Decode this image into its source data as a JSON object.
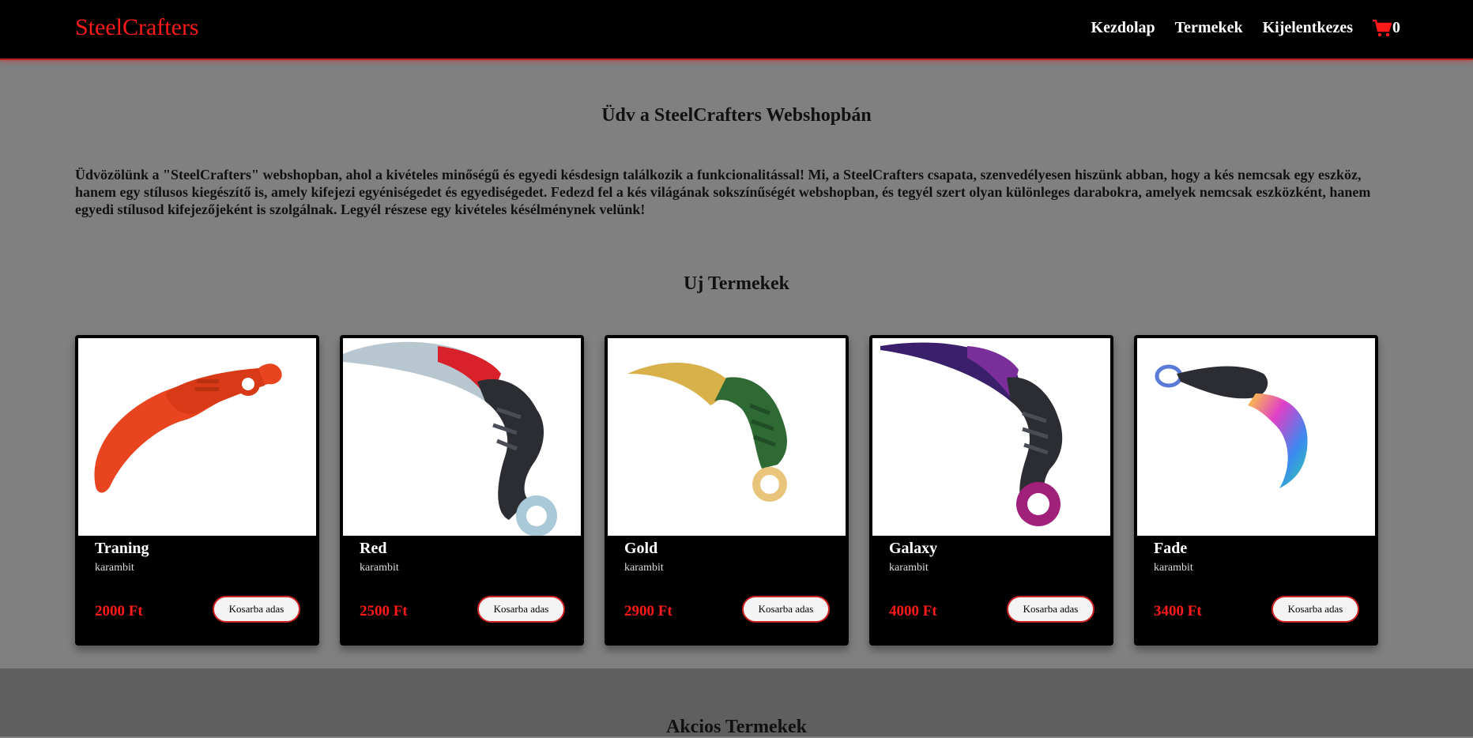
{
  "header": {
    "brand": "SteelCrafters",
    "nav": [
      "Kezdolap",
      "Termekek",
      "Kijelentkezes"
    ],
    "cart_count": "0",
    "colors": {
      "background": "#000000",
      "accent": "#ff1a1a"
    }
  },
  "welcome": {
    "title": "Üdv a SteelCrafters Webshopbán",
    "text": "Üdvözölünk a \"SteelCrafters\" webshopban, ahol a kivételes minőségű és egyedi késdesign találkozik a funkcionalitással! Mi, a SteelCrafters csapata, szenvedélyesen hiszünk abban, hogy a kés nemcsak egy eszköz, hanem egy stílusos kiegészítő is, amely kifejezi egyéniségedet és egyediségedet. Fedezd fel a kés világának sokszínűségét webshopban, és tegyél szert olyan különleges darabokra, amelyek nemcsak eszközként, hanem egyedi stílusod kifejezőjeként is szolgálnak. Legyél részese egy kivételes késélménynek velünk!"
  },
  "new_products": {
    "title": "Uj Termekek",
    "button_label": "Kosarba adas",
    "items": [
      {
        "name": "Traning",
        "type": "karambit",
        "price": "2000 Ft",
        "image": "orange-training-karambit"
      },
      {
        "name": "Red",
        "type": "karambit",
        "price": "2500 Ft",
        "image": "red-karambit"
      },
      {
        "name": "Gold",
        "type": "karambit",
        "price": "2900 Ft",
        "image": "gold-karambit"
      },
      {
        "name": "Galaxy",
        "type": "karambit",
        "price": "4000 Ft",
        "image": "galaxy-karambit"
      },
      {
        "name": "Fade",
        "type": "karambit",
        "price": "3400 Ft",
        "image": "fade-karambit"
      }
    ]
  },
  "sale_products": {
    "title": "Akcios Termekek"
  }
}
